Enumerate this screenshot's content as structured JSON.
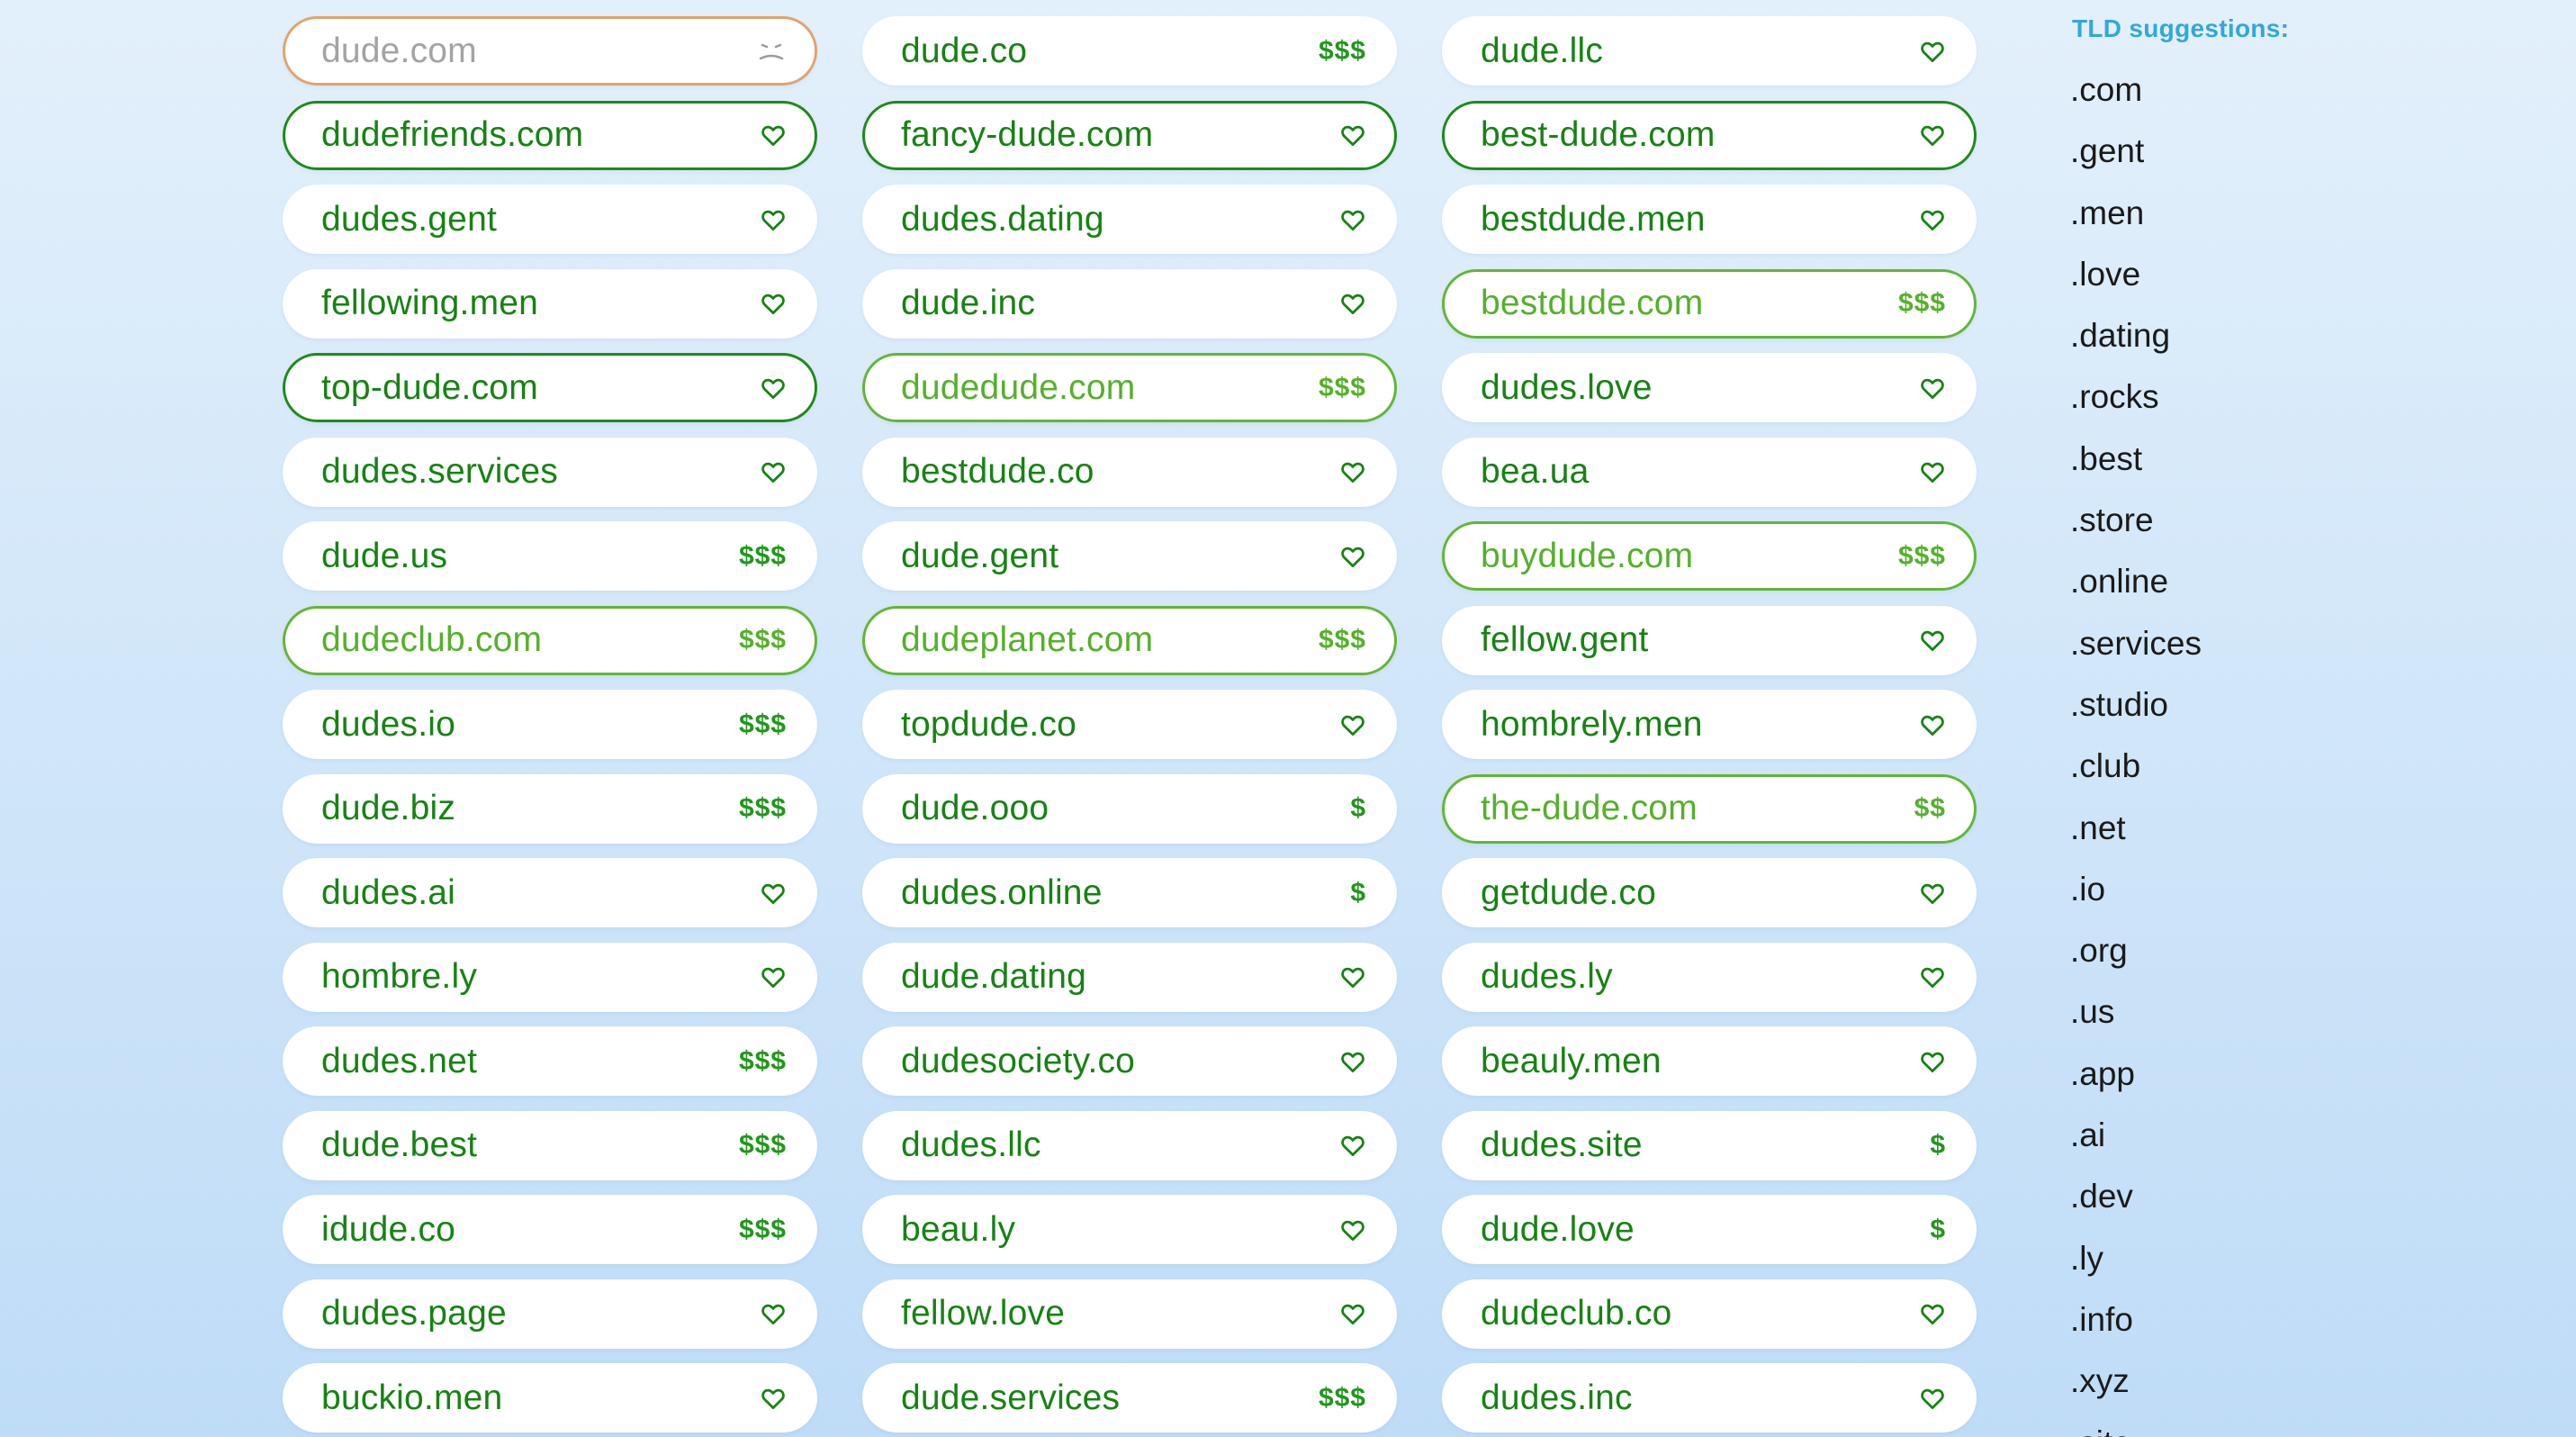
{
  "sidebar": {
    "title": "TLD suggestions:",
    "tlds": [
      ".com",
      ".gent",
      ".men",
      ".love",
      ".dating",
      ".rocks",
      ".best",
      ".store",
      ".online",
      ".services",
      ".studio",
      ".club",
      ".net",
      ".io",
      ".org",
      ".us",
      ".app",
      ".ai",
      ".dev",
      ".ly",
      ".info",
      ".xyz",
      ".site"
    ]
  },
  "domains": [
    {
      "name": "dude.com",
      "status": "taken",
      "indicator": "sad-face-icon"
    },
    {
      "name": "dude.co",
      "status": "available",
      "price": "$$$"
    },
    {
      "name": "dude.llc",
      "status": "available",
      "indicator": "heart-icon"
    },
    {
      "name": "dudefriends.com",
      "status": "outlined",
      "indicator": "heart-icon"
    },
    {
      "name": "fancy-dude.com",
      "status": "outlined",
      "indicator": "heart-icon"
    },
    {
      "name": "best-dude.com",
      "status": "outlined",
      "indicator": "heart-icon"
    },
    {
      "name": "dudes.gent",
      "status": "available",
      "indicator": "heart-icon"
    },
    {
      "name": "dudes.dating",
      "status": "available",
      "indicator": "heart-icon"
    },
    {
      "name": "bestdude.men",
      "status": "available",
      "indicator": "heart-icon"
    },
    {
      "name": "fellowing.men",
      "status": "available",
      "indicator": "heart-icon"
    },
    {
      "name": "dude.inc",
      "status": "available",
      "indicator": "heart-icon"
    },
    {
      "name": "bestdude.com",
      "status": "premium",
      "price": "$$$"
    },
    {
      "name": "top-dude.com",
      "status": "outlined",
      "indicator": "heart-icon"
    },
    {
      "name": "dudedude.com",
      "status": "premium",
      "price": "$$$"
    },
    {
      "name": "dudes.love",
      "status": "available",
      "indicator": "heart-icon"
    },
    {
      "name": "dudes.services",
      "status": "available",
      "indicator": "heart-icon"
    },
    {
      "name": "bestdude.co",
      "status": "available",
      "indicator": "heart-icon"
    },
    {
      "name": "bea.ua",
      "status": "available",
      "indicator": "heart-icon"
    },
    {
      "name": "dude.us",
      "status": "available",
      "price": "$$$"
    },
    {
      "name": "dude.gent",
      "status": "available",
      "indicator": "heart-icon"
    },
    {
      "name": "buydude.com",
      "status": "premium",
      "price": "$$$"
    },
    {
      "name": "dudeclub.com",
      "status": "premium",
      "price": "$$$"
    },
    {
      "name": "dudeplanet.com",
      "status": "premium",
      "price": "$$$"
    },
    {
      "name": "fellow.gent",
      "status": "available",
      "indicator": "heart-icon"
    },
    {
      "name": "dudes.io",
      "status": "available",
      "price": "$$$"
    },
    {
      "name": "topdude.co",
      "status": "available",
      "indicator": "heart-icon"
    },
    {
      "name": "hombrely.men",
      "status": "available",
      "indicator": "heart-icon"
    },
    {
      "name": "dude.biz",
      "status": "available",
      "price": "$$$"
    },
    {
      "name": "dude.ooo",
      "status": "available",
      "price": "$"
    },
    {
      "name": "the-dude.com",
      "status": "premium",
      "price": "$$"
    },
    {
      "name": "dudes.ai",
      "status": "available",
      "indicator": "heart-icon"
    },
    {
      "name": "dudes.online",
      "status": "available",
      "price": "$"
    },
    {
      "name": "getdude.co",
      "status": "available",
      "indicator": "heart-icon"
    },
    {
      "name": "hombre.ly",
      "status": "available",
      "indicator": "heart-icon"
    },
    {
      "name": "dude.dating",
      "status": "available",
      "indicator": "heart-icon"
    },
    {
      "name": "dudes.ly",
      "status": "available",
      "indicator": "heart-icon"
    },
    {
      "name": "dudes.net",
      "status": "available",
      "price": "$$$"
    },
    {
      "name": "dudesociety.co",
      "status": "available",
      "indicator": "heart-icon"
    },
    {
      "name": "beauly.men",
      "status": "available",
      "indicator": "heart-icon"
    },
    {
      "name": "dude.best",
      "status": "available",
      "price": "$$$"
    },
    {
      "name": "dudes.llc",
      "status": "available",
      "indicator": "heart-icon"
    },
    {
      "name": "dudes.site",
      "status": "available",
      "price": "$"
    },
    {
      "name": "idude.co",
      "status": "available",
      "price": "$$$"
    },
    {
      "name": "beau.ly",
      "status": "available",
      "indicator": "heart-icon"
    },
    {
      "name": "dude.love",
      "status": "available",
      "price": "$"
    },
    {
      "name": "dudes.page",
      "status": "available",
      "indicator": "heart-icon"
    },
    {
      "name": "fellow.love",
      "status": "available",
      "indicator": "heart-icon"
    },
    {
      "name": "dudeclub.co",
      "status": "available",
      "indicator": "heart-icon"
    },
    {
      "name": "buckio.men",
      "status": "available",
      "indicator": "heart-icon"
    },
    {
      "name": "dude.services",
      "status": "available",
      "price": "$$$"
    },
    {
      "name": "dudes.inc",
      "status": "available",
      "indicator": "heart-icon"
    }
  ]
}
